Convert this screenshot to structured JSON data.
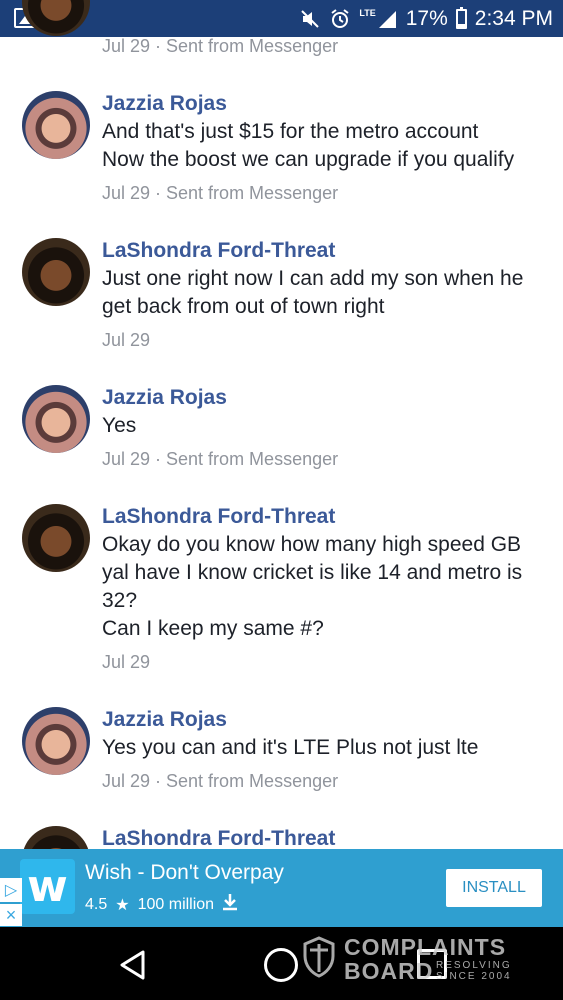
{
  "status_bar": {
    "battery": "17%",
    "time": "2:34 PM",
    "network": "LTE"
  },
  "messages": [
    {
      "meta": "Jul 29 · Sent from Messenger"
    },
    {
      "sender": "Jazzia Rojas",
      "lines": [
        "And that's just $15 for the metro account",
        "Now the boost we can upgrade if you qualify"
      ],
      "meta": "Jul 29 · Sent from Messenger"
    },
    {
      "sender": "LaShondra Ford-Threat",
      "lines": [
        "Just one right now I can add my son when he",
        "get back from out of town right"
      ],
      "meta": "Jul 29"
    },
    {
      "sender": "Jazzia Rojas",
      "lines": [
        "Yes"
      ],
      "meta": "Jul 29 · Sent from Messenger"
    },
    {
      "sender": "LaShondra Ford-Threat",
      "lines": [
        "Okay do you know how many high speed GB",
        "yal have I know cricket is like 14 and metro is",
        "32?",
        "Can I keep my same #?"
      ],
      "meta": "Jul 29"
    },
    {
      "sender": "Jazzia Rojas",
      "lines": [
        "Yes you can and it's LTE Plus not just lte"
      ],
      "meta": "Jul 29 · Sent from Messenger"
    },
    {
      "sender": "LaShondra Ford-Threat"
    }
  ],
  "ad": {
    "title": "Wish - Don't Overpay",
    "rating": "4.5",
    "downloads": "100 million",
    "install_label": "INSTALL",
    "icon_letter": "w"
  },
  "watermark": {
    "line1": "COMPLAINTS",
    "line2": "BOARD",
    "line3a": "RESOLVING",
    "line3b": "SINCE 2004"
  },
  "colors": {
    "status_bar": "#1c3f78",
    "name": "#3b5998",
    "meta": "#90949c",
    "ad_bg": "#2f9fd0"
  }
}
